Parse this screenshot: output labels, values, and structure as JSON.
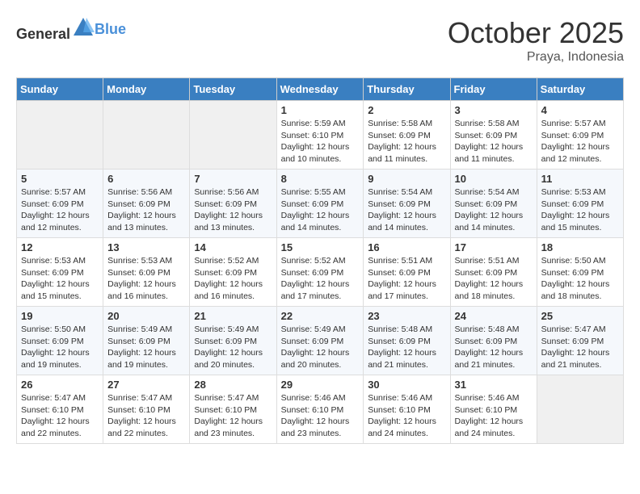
{
  "header": {
    "logo": {
      "text_general": "General",
      "text_blue": "Blue"
    },
    "title": "October 2025",
    "location": "Praya, Indonesia"
  },
  "weekdays": [
    "Sunday",
    "Monday",
    "Tuesday",
    "Wednesday",
    "Thursday",
    "Friday",
    "Saturday"
  ],
  "weeks": [
    [
      {
        "day": "",
        "sunrise": "",
        "sunset": "",
        "daylight": ""
      },
      {
        "day": "",
        "sunrise": "",
        "sunset": "",
        "daylight": ""
      },
      {
        "day": "",
        "sunrise": "",
        "sunset": "",
        "daylight": ""
      },
      {
        "day": "1",
        "sunrise": "Sunrise: 5:59 AM",
        "sunset": "Sunset: 6:10 PM",
        "daylight": "Daylight: 12 hours and 10 minutes."
      },
      {
        "day": "2",
        "sunrise": "Sunrise: 5:58 AM",
        "sunset": "Sunset: 6:09 PM",
        "daylight": "Daylight: 12 hours and 11 minutes."
      },
      {
        "day": "3",
        "sunrise": "Sunrise: 5:58 AM",
        "sunset": "Sunset: 6:09 PM",
        "daylight": "Daylight: 12 hours and 11 minutes."
      },
      {
        "day": "4",
        "sunrise": "Sunrise: 5:57 AM",
        "sunset": "Sunset: 6:09 PM",
        "daylight": "Daylight: 12 hours and 12 minutes."
      }
    ],
    [
      {
        "day": "5",
        "sunrise": "Sunrise: 5:57 AM",
        "sunset": "Sunset: 6:09 PM",
        "daylight": "Daylight: 12 hours and 12 minutes."
      },
      {
        "day": "6",
        "sunrise": "Sunrise: 5:56 AM",
        "sunset": "Sunset: 6:09 PM",
        "daylight": "Daylight: 12 hours and 13 minutes."
      },
      {
        "day": "7",
        "sunrise": "Sunrise: 5:56 AM",
        "sunset": "Sunset: 6:09 PM",
        "daylight": "Daylight: 12 hours and 13 minutes."
      },
      {
        "day": "8",
        "sunrise": "Sunrise: 5:55 AM",
        "sunset": "Sunset: 6:09 PM",
        "daylight": "Daylight: 12 hours and 14 minutes."
      },
      {
        "day": "9",
        "sunrise": "Sunrise: 5:54 AM",
        "sunset": "Sunset: 6:09 PM",
        "daylight": "Daylight: 12 hours and 14 minutes."
      },
      {
        "day": "10",
        "sunrise": "Sunrise: 5:54 AM",
        "sunset": "Sunset: 6:09 PM",
        "daylight": "Daylight: 12 hours and 14 minutes."
      },
      {
        "day": "11",
        "sunrise": "Sunrise: 5:53 AM",
        "sunset": "Sunset: 6:09 PM",
        "daylight": "Daylight: 12 hours and 15 minutes."
      }
    ],
    [
      {
        "day": "12",
        "sunrise": "Sunrise: 5:53 AM",
        "sunset": "Sunset: 6:09 PM",
        "daylight": "Daylight: 12 hours and 15 minutes."
      },
      {
        "day": "13",
        "sunrise": "Sunrise: 5:53 AM",
        "sunset": "Sunset: 6:09 PM",
        "daylight": "Daylight: 12 hours and 16 minutes."
      },
      {
        "day": "14",
        "sunrise": "Sunrise: 5:52 AM",
        "sunset": "Sunset: 6:09 PM",
        "daylight": "Daylight: 12 hours and 16 minutes."
      },
      {
        "day": "15",
        "sunrise": "Sunrise: 5:52 AM",
        "sunset": "Sunset: 6:09 PM",
        "daylight": "Daylight: 12 hours and 17 minutes."
      },
      {
        "day": "16",
        "sunrise": "Sunrise: 5:51 AM",
        "sunset": "Sunset: 6:09 PM",
        "daylight": "Daylight: 12 hours and 17 minutes."
      },
      {
        "day": "17",
        "sunrise": "Sunrise: 5:51 AM",
        "sunset": "Sunset: 6:09 PM",
        "daylight": "Daylight: 12 hours and 18 minutes."
      },
      {
        "day": "18",
        "sunrise": "Sunrise: 5:50 AM",
        "sunset": "Sunset: 6:09 PM",
        "daylight": "Daylight: 12 hours and 18 minutes."
      }
    ],
    [
      {
        "day": "19",
        "sunrise": "Sunrise: 5:50 AM",
        "sunset": "Sunset: 6:09 PM",
        "daylight": "Daylight: 12 hours and 19 minutes."
      },
      {
        "day": "20",
        "sunrise": "Sunrise: 5:49 AM",
        "sunset": "Sunset: 6:09 PM",
        "daylight": "Daylight: 12 hours and 19 minutes."
      },
      {
        "day": "21",
        "sunrise": "Sunrise: 5:49 AM",
        "sunset": "Sunset: 6:09 PM",
        "daylight": "Daylight: 12 hours and 20 minutes."
      },
      {
        "day": "22",
        "sunrise": "Sunrise: 5:49 AM",
        "sunset": "Sunset: 6:09 PM",
        "daylight": "Daylight: 12 hours and 20 minutes."
      },
      {
        "day": "23",
        "sunrise": "Sunrise: 5:48 AM",
        "sunset": "Sunset: 6:09 PM",
        "daylight": "Daylight: 12 hours and 21 minutes."
      },
      {
        "day": "24",
        "sunrise": "Sunrise: 5:48 AM",
        "sunset": "Sunset: 6:09 PM",
        "daylight": "Daylight: 12 hours and 21 minutes."
      },
      {
        "day": "25",
        "sunrise": "Sunrise: 5:47 AM",
        "sunset": "Sunset: 6:09 PM",
        "daylight": "Daylight: 12 hours and 21 minutes."
      }
    ],
    [
      {
        "day": "26",
        "sunrise": "Sunrise: 5:47 AM",
        "sunset": "Sunset: 6:10 PM",
        "daylight": "Daylight: 12 hours and 22 minutes."
      },
      {
        "day": "27",
        "sunrise": "Sunrise: 5:47 AM",
        "sunset": "Sunset: 6:10 PM",
        "daylight": "Daylight: 12 hours and 22 minutes."
      },
      {
        "day": "28",
        "sunrise": "Sunrise: 5:47 AM",
        "sunset": "Sunset: 6:10 PM",
        "daylight": "Daylight: 12 hours and 23 minutes."
      },
      {
        "day": "29",
        "sunrise": "Sunrise: 5:46 AM",
        "sunset": "Sunset: 6:10 PM",
        "daylight": "Daylight: 12 hours and 23 minutes."
      },
      {
        "day": "30",
        "sunrise": "Sunrise: 5:46 AM",
        "sunset": "Sunset: 6:10 PM",
        "daylight": "Daylight: 12 hours and 24 minutes."
      },
      {
        "day": "31",
        "sunrise": "Sunrise: 5:46 AM",
        "sunset": "Sunset: 6:10 PM",
        "daylight": "Daylight: 12 hours and 24 minutes."
      },
      {
        "day": "",
        "sunrise": "",
        "sunset": "",
        "daylight": ""
      }
    ]
  ]
}
